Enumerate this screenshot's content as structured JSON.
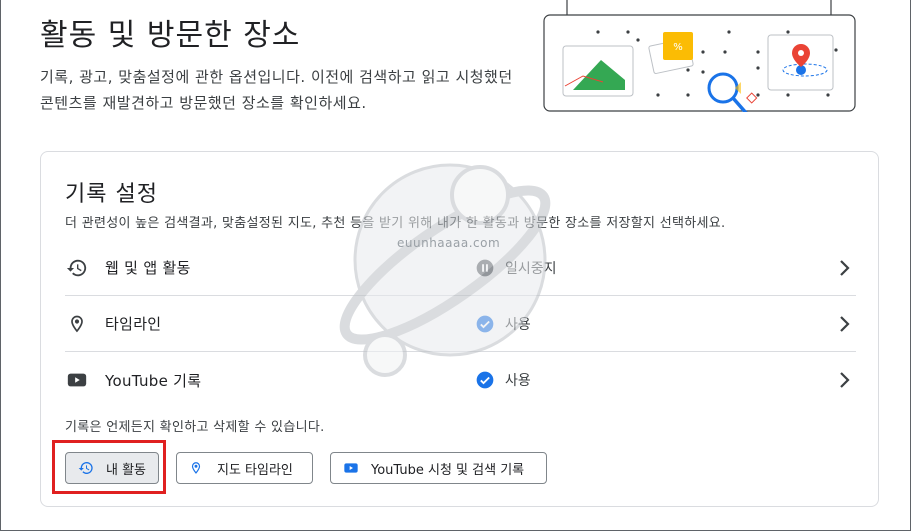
{
  "header": {
    "title": "활동 및 방문한 장소",
    "description": "기록, 광고, 맞춤설정에 관한 옵션입니다. 이전에 검색하고 읽고 시청했던 콘텐츠를 재발견하고 방문했던 장소를 확인하세요."
  },
  "history_settings": {
    "title": "기록 설정",
    "description": "더 관련성이 높은 검색결과, 맞춤설정된 지도, 추천 등을 받기 위해 내가 한 활동과 방문한 장소를 저장할지 선택하세요.",
    "rows": [
      {
        "label": "웹 및 앱 활동",
        "icon": "history-icon",
        "status": "일시중지",
        "status_icon": "pause-circle-icon"
      },
      {
        "label": "타임라인",
        "icon": "location-pin-icon",
        "status": "사용",
        "status_icon": "check-circle-icon"
      },
      {
        "label": "YouTube 기록",
        "icon": "youtube-icon",
        "status": "사용",
        "status_icon": "check-circle-icon"
      }
    ],
    "footer_note": "기록은 언제든지 확인하고 삭제할 수 있습니다.",
    "buttons": [
      {
        "label": "내 활동",
        "icon": "history-icon"
      },
      {
        "label": "지도 타임라인",
        "icon": "location-pin-icon"
      },
      {
        "label": "YouTube 시청 및 검색 기록",
        "icon": "youtube-icon"
      }
    ]
  },
  "watermark": {
    "text": "euunhaaaa.com"
  },
  "colors": {
    "accent_blue": "#1a73e8",
    "highlight_red": "#e02020",
    "text_primary": "#202124",
    "border": "#dadce0"
  }
}
